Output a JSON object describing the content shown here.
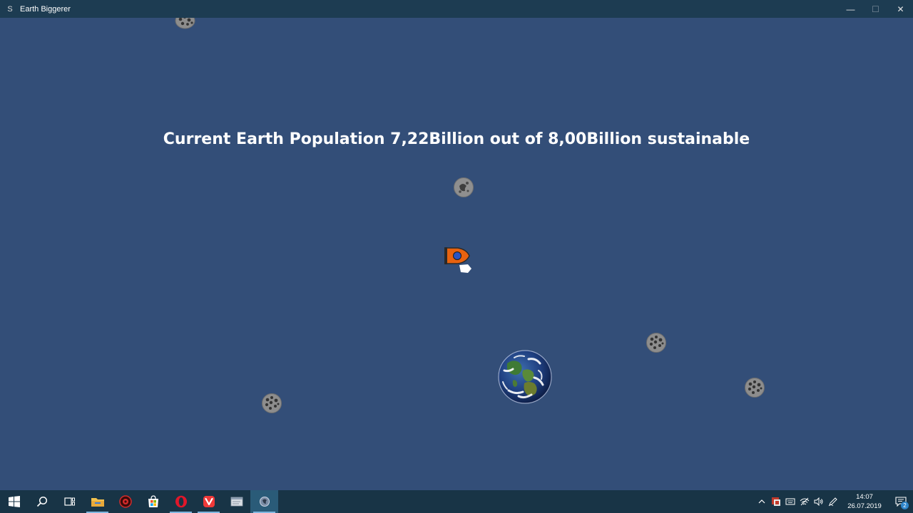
{
  "window": {
    "title": "Earth Biggerer",
    "app_icon_glyph": "S",
    "controls": {
      "minimize": "—",
      "maximize": "☐",
      "close": "✕"
    }
  },
  "hud": {
    "population_text": "Current Earth Population 7,22Billion out of 8,00Billion sustainable"
  },
  "colors": {
    "space_background": "#334e78",
    "title_bar": "#1d3c52",
    "taskbar": "#183446",
    "rocket_body": "#e8620f",
    "rocket_window": "#2a54c2"
  },
  "sprites": {
    "player": "rocket-ship-icon",
    "planet": "earth-globe-icon",
    "asteroid": "asteroid-icon"
  },
  "taskbar": {
    "apps": [
      "windows-start-icon",
      "search-icon",
      "task-view-icon",
      "file-explorer-icon",
      "red-app-icon",
      "microsoft-store-icon",
      "opera-browser-icon",
      "vivaldi-browser-icon",
      "notepad-app-icon",
      "game-app-icon"
    ],
    "tray": {
      "icons": [
        "chevron-up-icon",
        "tray-app-icon",
        "keyboard-icon",
        "wifi-icon",
        "volume-icon",
        "pen-icon"
      ],
      "time": "14:07",
      "date": "26.07.2019",
      "notification_count": "2"
    }
  }
}
